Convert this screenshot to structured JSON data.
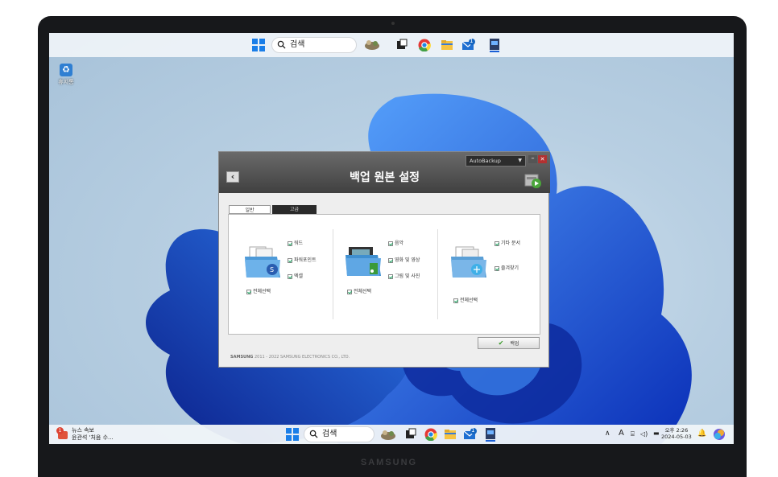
{
  "desktop": {
    "recycle_bin_label": "휴지통",
    "brand": "SAMSUNG"
  },
  "top_taskbar": {
    "search_placeholder": "검색",
    "notification_count": "1"
  },
  "app": {
    "title": "백업 원본 설정",
    "mode_dropdown": "AutoBackup",
    "tabs": [
      {
        "label": "일반"
      },
      {
        "label": "고급"
      }
    ],
    "groups": [
      {
        "items": [
          "워드",
          "파워포인트",
          "엑셀"
        ],
        "select_all": "전체선택"
      },
      {
        "items": [
          "음악",
          "영화 및 영상",
          "그림 및 사진"
        ],
        "select_all": "전체선택"
      },
      {
        "items": [
          "기타 문서",
          "즐겨찾기"
        ],
        "select_all": "전체선택"
      }
    ],
    "backup_button": "백업",
    "copyright_brand": "SAMSUNG",
    "copyright_text": "2011 - 2022 SAMSUNG ELECTRONICS CO., LTD."
  },
  "bottom_taskbar": {
    "news_badge": "1",
    "news_line1": "뉴스 속보",
    "news_line2": "윤관석 '처음 수...",
    "search_placeholder": "검색",
    "notification_count": "1",
    "ime": "A",
    "time": "오후 2:26",
    "date": "2024-05-03"
  },
  "colors": {
    "accent_blue": "#1a5fd6",
    "taskbar": "#f0f4f8",
    "app_header": "#4a4a4a",
    "check_green": "#3a9a2a"
  }
}
